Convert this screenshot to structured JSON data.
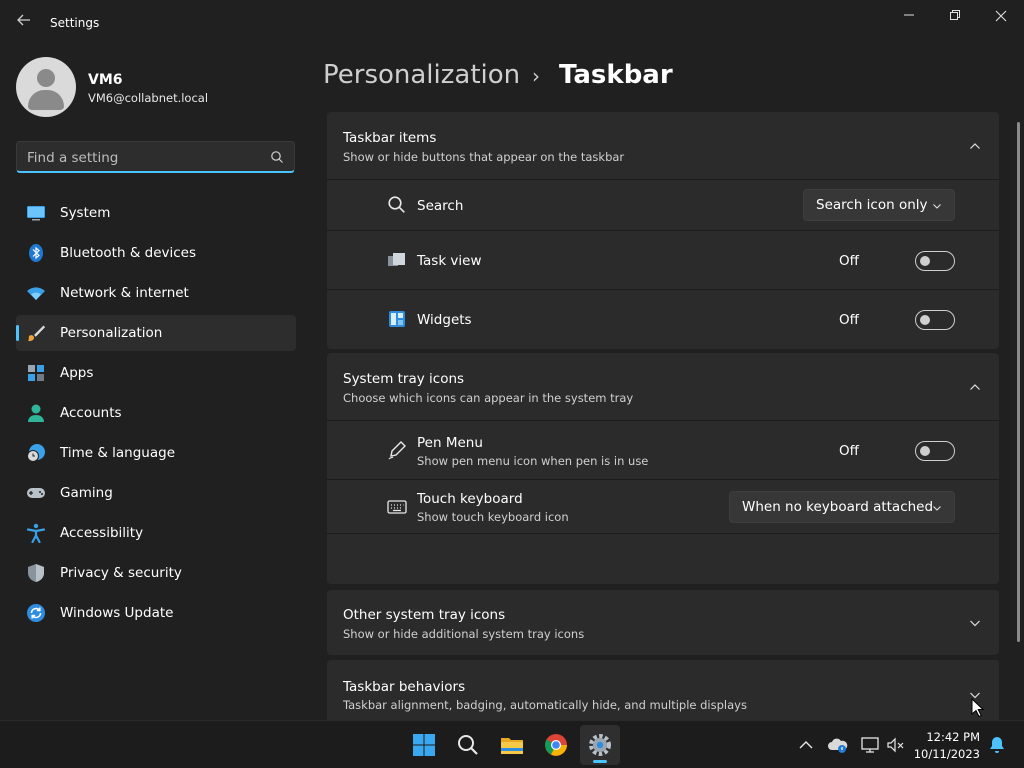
{
  "window": {
    "title": "Settings",
    "back_icon": "arrow-left-icon",
    "minimize_icon": "minimize-icon",
    "maximize_icon": "restore-icon",
    "close_icon": "close-icon"
  },
  "profile": {
    "name": "VM6",
    "email": "VM6@collabnet.local"
  },
  "search": {
    "placeholder": "Find a setting",
    "value": ""
  },
  "nav": {
    "items": [
      {
        "label": "System",
        "icon": "monitor-icon"
      },
      {
        "label": "Bluetooth & devices",
        "icon": "bluetooth-icon"
      },
      {
        "label": "Network & internet",
        "icon": "wifi-icon"
      },
      {
        "label": "Personalization",
        "icon": "paintbrush-icon",
        "active": true
      },
      {
        "label": "Apps",
        "icon": "apps-icon"
      },
      {
        "label": "Accounts",
        "icon": "person-icon"
      },
      {
        "label": "Time & language",
        "icon": "globe-clock-icon"
      },
      {
        "label": "Gaming",
        "icon": "gamepad-icon"
      },
      {
        "label": "Accessibility",
        "icon": "accessibility-icon"
      },
      {
        "label": "Privacy & security",
        "icon": "shield-icon"
      },
      {
        "label": "Windows Update",
        "icon": "sync-icon"
      }
    ]
  },
  "header": {
    "parent": "Personalization",
    "separator": "›",
    "current": "Taskbar"
  },
  "sections": {
    "taskbar_items": {
      "title": "Taskbar items",
      "subtitle": "Show or hide buttons that appear on the taskbar",
      "expanded": true,
      "rows": {
        "search": {
          "label": "Search",
          "value": "Search icon only"
        },
        "task_view": {
          "label": "Task view",
          "state": "Off"
        },
        "widgets": {
          "label": "Widgets",
          "state": "Off"
        }
      }
    },
    "system_tray": {
      "title": "System tray icons",
      "subtitle": "Choose which icons can appear in the system tray",
      "expanded": true,
      "rows": {
        "pen_menu": {
          "label": "Pen Menu",
          "sub": "Show pen menu icon when pen is in use",
          "state": "Off"
        },
        "touch_keyboard": {
          "label": "Touch keyboard",
          "sub": "Show touch keyboard icon",
          "value": "When no keyboard attached"
        }
      }
    },
    "other_tray": {
      "title": "Other system tray icons",
      "subtitle": "Show or hide additional system tray icons",
      "expanded": false
    },
    "behaviors": {
      "title": "Taskbar behaviors",
      "subtitle": "Taskbar alignment, badging, automatically hide, and multiple displays",
      "expanded": false
    }
  },
  "taskbar": {
    "apps": [
      "windows-start-icon",
      "search-icon",
      "file-explorer-icon",
      "chrome-icon",
      "settings-gear-icon"
    ],
    "active_app": "settings-gear-icon",
    "tray_icons": [
      "chevron-up-icon",
      "onedrive-icon",
      "display-icon",
      "speaker-muted-icon",
      "notification-bell-icon"
    ],
    "time": "12:42 PM",
    "date": "10/11/2023"
  },
  "colors": {
    "accent": "#4cc2ff",
    "background": "#202020",
    "card": "#2b2b2b"
  }
}
